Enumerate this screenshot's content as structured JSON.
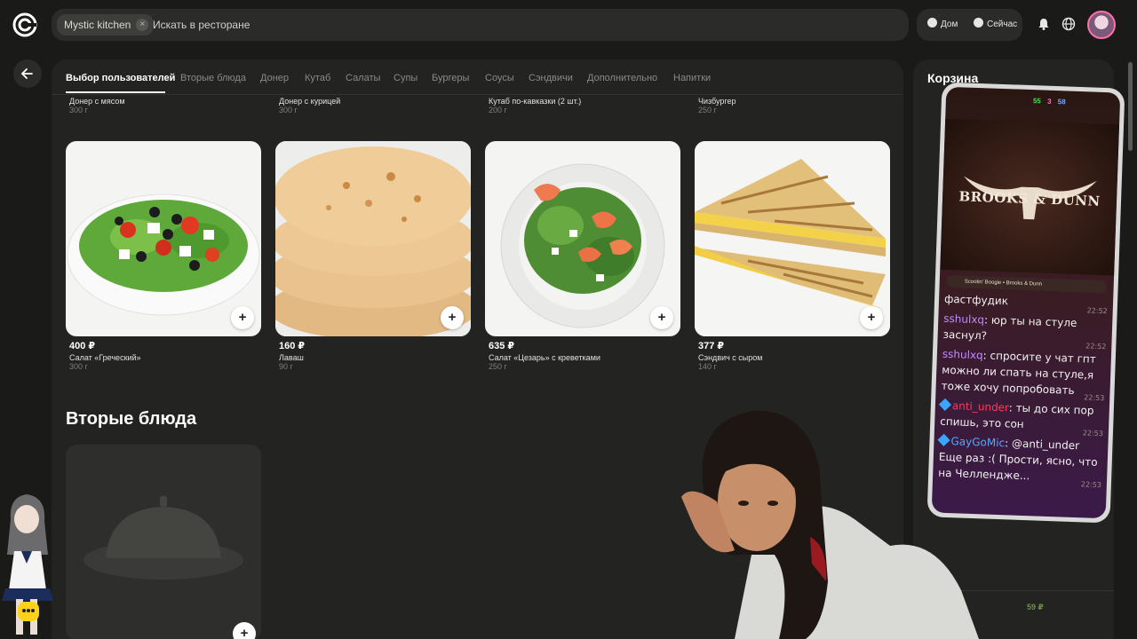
{
  "header": {
    "restaurant_chip": "Mystic kitchen",
    "chip_close": "×",
    "search_placeholder": "Искать в ресторане",
    "location_home": "Дом",
    "delivery_time": "Сейчас"
  },
  "tabs": [
    "Выбор пользователей",
    "Вторые блюда",
    "Донер",
    "Кутаб",
    "Салаты",
    "Супы",
    "Бургеры",
    "Соусы",
    "Сэндвичи",
    "Дополнительно",
    "Напитки"
  ],
  "previous_row": [
    {
      "name": "Донер с мясом",
      "weight": "300 г"
    },
    {
      "name": "Донер с курицей",
      "weight": "300 г"
    },
    {
      "name": "Кутаб по-кавказки (2 шт.)",
      "weight": "200 г"
    },
    {
      "name": "Чизбургер",
      "weight": "250 г"
    }
  ],
  "dishes": [
    {
      "price": "400 ₽",
      "name": "Салат «Греческий»",
      "weight": "300 г",
      "add": "+"
    },
    {
      "price": "160 ₽",
      "name": "Лаваш",
      "weight": "90 г",
      "add": "+"
    },
    {
      "price": "635 ₽",
      "name": "Салат «Цезарь» с креветками",
      "weight": "250 г",
      "add": "+"
    },
    {
      "price": "377 ₽",
      "name": "Сэндвич с сыром",
      "weight": "140 г",
      "add": "+"
    }
  ],
  "section2": {
    "title": "Вторые блюда",
    "add": "+"
  },
  "cart": {
    "title": "Корзина",
    "price_fragment": "59 ₽"
  },
  "stream_overlay": {
    "stats": {
      "green": "55",
      "pink": "3",
      "blue": "58"
    },
    "album_text": "BROOKS & DUNN",
    "song": "Scootin' Boogie • Brooks & Dunn",
    "messages": [
      {
        "user": "",
        "text": "фастфудик",
        "time": "22:52"
      },
      {
        "user": "sshulxq",
        "text": ": юр ты на стуле заснул?",
        "time": "22:52"
      },
      {
        "user": "sshulxq",
        "text": ": спросите у чат гпт можно ли спать на стуле,я тоже хочу попробовать",
        "time": "22:53"
      },
      {
        "user": "anti_under",
        "text": ": ты до сих пор спишь, это сон",
        "time": "22:53"
      },
      {
        "user": "GayGoMic",
        "text": ": @anti_under Еще раз :( Прости, ясно, что на Челлендже...",
        "time": "22:53"
      }
    ]
  }
}
